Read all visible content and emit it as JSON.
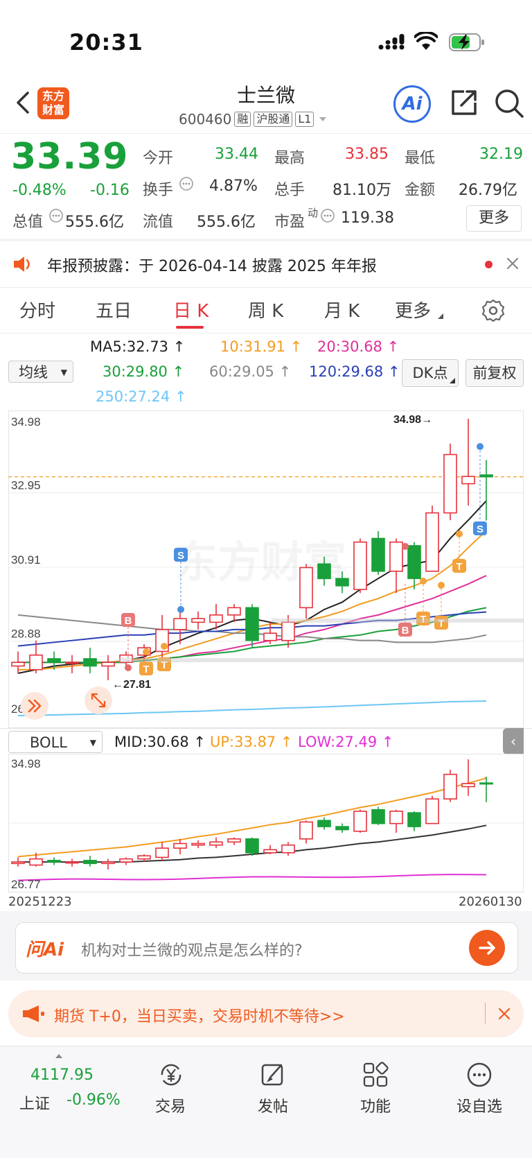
{
  "status_bar": {
    "time": "20:31"
  },
  "header": {
    "logo_line1": "东方",
    "logo_line2": "财富",
    "stock_name": "士兰微",
    "stock_code": "600460",
    "tags": [
      "融",
      "沪股通",
      "L1"
    ],
    "ai_label": "Ai"
  },
  "quote": {
    "price": "33.39",
    "change_pct": "-0.48%",
    "change": "-0.16",
    "open_label": "今开",
    "open": "33.44",
    "high_label": "最高",
    "high": "33.85",
    "low_label": "最低",
    "low": "32.19",
    "turnover_label": "换手",
    "turnover": "4.87%",
    "volume_label": "总手",
    "volume": "81.10万",
    "amount_label": "金额",
    "amount": "26.79亿",
    "total_cap_label": "总值",
    "total_cap": "555.6亿",
    "float_cap_label": "流值",
    "float_cap": "555.6亿",
    "pe_label": "市盈",
    "pe_sup": "动",
    "pe": "119.38",
    "more_label": "更多"
  },
  "notice": {
    "text": "年报预披露：于 2026-04-14 披露 2025 年年报"
  },
  "tabs": [
    "分时",
    "五日",
    "日 K",
    "周 K",
    "月 K",
    "更多"
  ],
  "active_tab": "日 K",
  "ma_panel": {
    "indicator_select": "均线",
    "ma5": "MA5:32.73",
    "ma10": "10:31.91",
    "ma20": "20:30.68",
    "ma30": "30:29.80",
    "ma60": "60:29.05",
    "ma120": "120:29.68",
    "ma250": "250:27.24",
    "dk_button": "DK点",
    "adjust_button": "前复权"
  },
  "chart_data": [
    {
      "type": "candlestick",
      "y_ticks": [
        "34.98",
        "32.95",
        "30.91",
        "28.88",
        "26.84"
      ],
      "ylim": [
        26.84,
        34.98
      ],
      "current_price_line": 33.39,
      "annotations": {
        "high": "34.98",
        "low": "27.81"
      },
      "candles": [
        {
          "o": 28.2,
          "c": 28.3,
          "h": 28.6,
          "l": 28.0
        },
        {
          "o": 28.1,
          "c": 28.5,
          "h": 28.9,
          "l": 28.0
        },
        {
          "o": 28.4,
          "c": 28.3,
          "h": 28.6,
          "l": 28.1
        },
        {
          "o": 28.3,
          "c": 28.3,
          "h": 28.5,
          "l": 28.0
        },
        {
          "o": 28.4,
          "c": 28.2,
          "h": 28.7,
          "l": 28.0
        },
        {
          "o": 28.2,
          "c": 28.3,
          "h": 28.5,
          "l": 27.81
        },
        {
          "o": 28.3,
          "c": 28.5,
          "h": 28.6,
          "l": 28.1
        },
        {
          "o": 28.5,
          "c": 28.7,
          "h": 28.8,
          "l": 28.3
        },
        {
          "o": 28.6,
          "c": 29.2,
          "h": 29.6,
          "l": 28.4
        },
        {
          "o": 29.2,
          "c": 29.5,
          "h": 29.8,
          "l": 28.8
        },
        {
          "o": 29.4,
          "c": 29.5,
          "h": 29.7,
          "l": 29.2
        },
        {
          "o": 29.4,
          "c": 29.6,
          "h": 29.9,
          "l": 29.2
        },
        {
          "o": 29.6,
          "c": 29.8,
          "h": 29.9,
          "l": 29.4
        },
        {
          "o": 29.8,
          "c": 28.9,
          "h": 29.9,
          "l": 28.7
        },
        {
          "o": 28.9,
          "c": 29.1,
          "h": 29.4,
          "l": 28.8
        },
        {
          "o": 28.9,
          "c": 29.4,
          "h": 29.6,
          "l": 28.7
        },
        {
          "o": 29.8,
          "c": 30.9,
          "h": 31.0,
          "l": 29.5
        },
        {
          "o": 31.0,
          "c": 30.6,
          "h": 31.2,
          "l": 30.4
        },
        {
          "o": 30.6,
          "c": 30.4,
          "h": 30.8,
          "l": 30.2
        },
        {
          "o": 30.3,
          "c": 31.6,
          "h": 31.7,
          "l": 30.2
        },
        {
          "o": 31.7,
          "c": 30.8,
          "h": 31.9,
          "l": 30.7
        },
        {
          "o": 30.8,
          "c": 31.6,
          "h": 31.7,
          "l": 30.2
        },
        {
          "o": 31.5,
          "c": 30.6,
          "h": 31.6,
          "l": 30.3
        },
        {
          "o": 30.8,
          "c": 32.4,
          "h": 32.6,
          "l": 30.8
        },
        {
          "o": 32.4,
          "c": 34.0,
          "h": 34.3,
          "l": 32.2
        },
        {
          "o": 33.2,
          "c": 33.4,
          "h": 34.98,
          "l": 32.6
        },
        {
          "o": 33.44,
          "c": 33.39,
          "h": 33.85,
          "l": 32.19
        }
      ],
      "ma_lines": {
        "ma5": [
          28.0,
          28.1,
          28.2,
          28.25,
          28.3,
          28.3,
          28.35,
          28.45,
          28.7,
          28.9,
          29.1,
          29.25,
          29.45,
          29.5,
          29.4,
          29.3,
          29.45,
          29.75,
          29.95,
          30.3,
          30.6,
          30.9,
          31.0,
          31.1,
          31.7,
          32.2,
          32.73
        ],
        "ma10": [
          28.1,
          28.1,
          28.15,
          28.2,
          28.25,
          28.3,
          28.35,
          28.4,
          28.5,
          28.65,
          28.8,
          28.95,
          29.1,
          29.25,
          29.35,
          29.35,
          29.45,
          29.55,
          29.7,
          29.9,
          30.05,
          30.25,
          30.4,
          30.6,
          30.95,
          31.45,
          31.91
        ],
        "ma20": [
          28.3,
          28.3,
          28.3,
          28.3,
          28.3,
          28.3,
          28.3,
          28.35,
          28.4,
          28.45,
          28.55,
          28.6,
          28.7,
          28.8,
          28.9,
          28.95,
          29.1,
          29.2,
          29.35,
          29.5,
          29.6,
          29.75,
          29.9,
          30.05,
          30.25,
          30.45,
          30.68
        ],
        "ma30": [
          28.3,
          28.3,
          28.3,
          28.3,
          28.3,
          28.3,
          28.3,
          28.35,
          28.4,
          28.45,
          28.5,
          28.55,
          28.6,
          28.7,
          28.75,
          28.8,
          28.85,
          28.95,
          29.0,
          29.05,
          29.15,
          29.2,
          29.3,
          29.4,
          29.55,
          29.7,
          29.8
        ],
        "ma60": [
          29.6,
          29.55,
          29.5,
          29.45,
          29.4,
          29.35,
          29.3,
          29.25,
          29.2,
          29.2,
          29.15,
          29.15,
          29.1,
          29.1,
          29.05,
          29.0,
          29.0,
          28.95,
          28.95,
          28.9,
          28.9,
          28.85,
          28.85,
          28.85,
          28.9,
          28.95,
          29.05
        ],
        "ma120": [
          28.75,
          28.8,
          28.85,
          28.9,
          28.95,
          29.0,
          29.05,
          29.05,
          29.1,
          29.1,
          29.15,
          29.15,
          29.2,
          29.2,
          29.25,
          29.25,
          29.3,
          29.3,
          29.35,
          29.4,
          29.45,
          29.45,
          29.5,
          29.55,
          29.6,
          29.65,
          29.68
        ],
        "ma250": [
          26.84,
          26.85,
          26.86,
          26.87,
          26.88,
          26.89,
          26.9,
          26.92,
          26.93,
          26.95,
          26.96,
          26.98,
          27.0,
          27.01,
          27.03,
          27.05,
          27.06,
          27.08,
          27.1,
          27.12,
          27.14,
          27.16,
          27.18,
          27.2,
          27.22,
          27.23,
          27.24
        ]
      }
    },
    {
      "type": "boll",
      "indicator_select": "BOLL",
      "mid_label": "MID:30.68",
      "up_label": "UP:33.87",
      "low_label": "LOW:27.49",
      "y_ticks": [
        "34.98",
        "26.77"
      ],
      "x_start": "20251223",
      "x_end": "20260130"
    }
  ],
  "ask": {
    "brand": "问Ai",
    "placeholder": "机构对士兰微的观点是怎么样的?"
  },
  "promo": {
    "text": "期货 T+0，当日买卖，交易时机不等待>>"
  },
  "bottom_nav": {
    "index_value": "4117.95",
    "index_name": "上证",
    "index_change": "-0.96%",
    "items": [
      "交易",
      "发帖",
      "功能",
      "设自选"
    ]
  },
  "colors": {
    "up": "#e5323c",
    "down": "#19a03a",
    "ma5": "#222222",
    "ma10": "#f39c1e",
    "ma20": "#e0309a",
    "ma30": "#19a03a",
    "ma60": "#888888",
    "ma120": "#2a3fb5",
    "ma250": "#6ec6f5",
    "accent": "#f05a1e"
  }
}
